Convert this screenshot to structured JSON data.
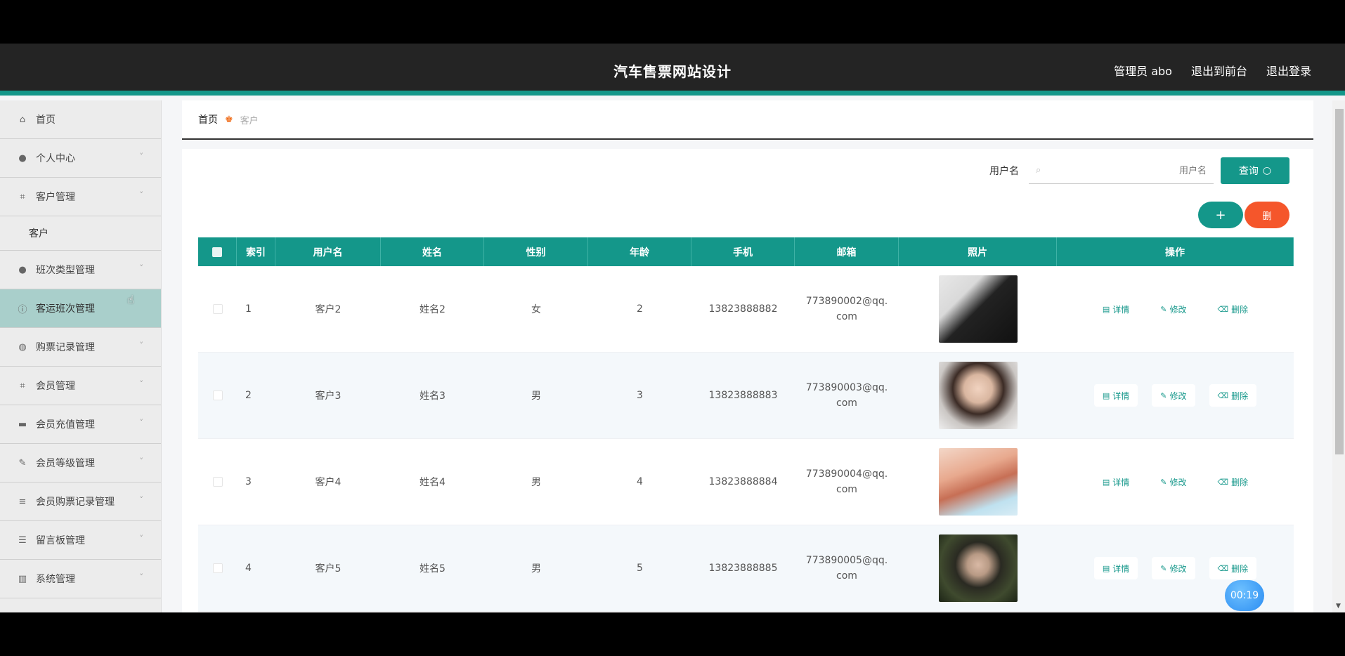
{
  "header": {
    "title": "汽车售票网站设计",
    "user": "管理员 abo",
    "front_link": "退出到前台",
    "logout": "退出登录"
  },
  "sidebar": {
    "items": [
      {
        "label": "首页",
        "icon": "home-icon",
        "chevron": ""
      },
      {
        "label": "个人中心",
        "icon": "user-icon",
        "chevron": "˅"
      },
      {
        "label": "客户管理",
        "icon": "grid-icon",
        "chevron": "˅"
      },
      {
        "label": "班次类型管理",
        "icon": "user-icon",
        "chevron": "˅"
      },
      {
        "label": "客运班次管理",
        "icon": "info-icon",
        "chevron": ""
      },
      {
        "label": "购票记录管理",
        "icon": "globe-icon",
        "chevron": "˅"
      },
      {
        "label": "会员管理",
        "icon": "grid-icon",
        "chevron": "˅"
      },
      {
        "label": "会员充值管理",
        "icon": "card-icon",
        "chevron": "˅"
      },
      {
        "label": "会员等级管理",
        "icon": "edit-icon",
        "chevron": "˅"
      },
      {
        "label": "会员购票记录管理",
        "icon": "list-icon",
        "chevron": "˅"
      },
      {
        "label": "留言板管理",
        "icon": "sliders-icon",
        "chevron": "˅"
      },
      {
        "label": "系统管理",
        "icon": "chart-icon",
        "chevron": "˅"
      }
    ],
    "sub_item": "客户"
  },
  "breadcrumb": {
    "home": "首页",
    "current": "客户"
  },
  "search": {
    "label": "用户名",
    "placeholder": "用户名",
    "button": "查询"
  },
  "actions": {
    "add": "+",
    "delete": "删"
  },
  "table": {
    "columns": [
      "",
      "索引",
      "用户名",
      "姓名",
      "性别",
      "年龄",
      "手机",
      "邮箱",
      "照片",
      "操作"
    ],
    "rows": [
      {
        "index": "1",
        "username": "客户2",
        "name": "姓名2",
        "gender": "女",
        "age": "2",
        "phone": "13823888882",
        "email1": "773890002@qq.",
        "email2": "com"
      },
      {
        "index": "2",
        "username": "客户3",
        "name": "姓名3",
        "gender": "男",
        "age": "3",
        "phone": "13823888883",
        "email1": "773890003@qq.",
        "email2": "com"
      },
      {
        "index": "3",
        "username": "客户4",
        "name": "姓名4",
        "gender": "男",
        "age": "4",
        "phone": "13823888884",
        "email1": "773890004@qq.",
        "email2": "com"
      },
      {
        "index": "4",
        "username": "客户5",
        "name": "姓名5",
        "gender": "男",
        "age": "5",
        "phone": "13823888885",
        "email1": "773890005@qq.",
        "email2": "com"
      }
    ],
    "ops": {
      "detail": "详情",
      "edit": "修改",
      "delete": "删除"
    }
  },
  "timer": "00:19",
  "colors": {
    "accent": "#14978a",
    "danger": "#f5562b",
    "header": "#242424"
  }
}
